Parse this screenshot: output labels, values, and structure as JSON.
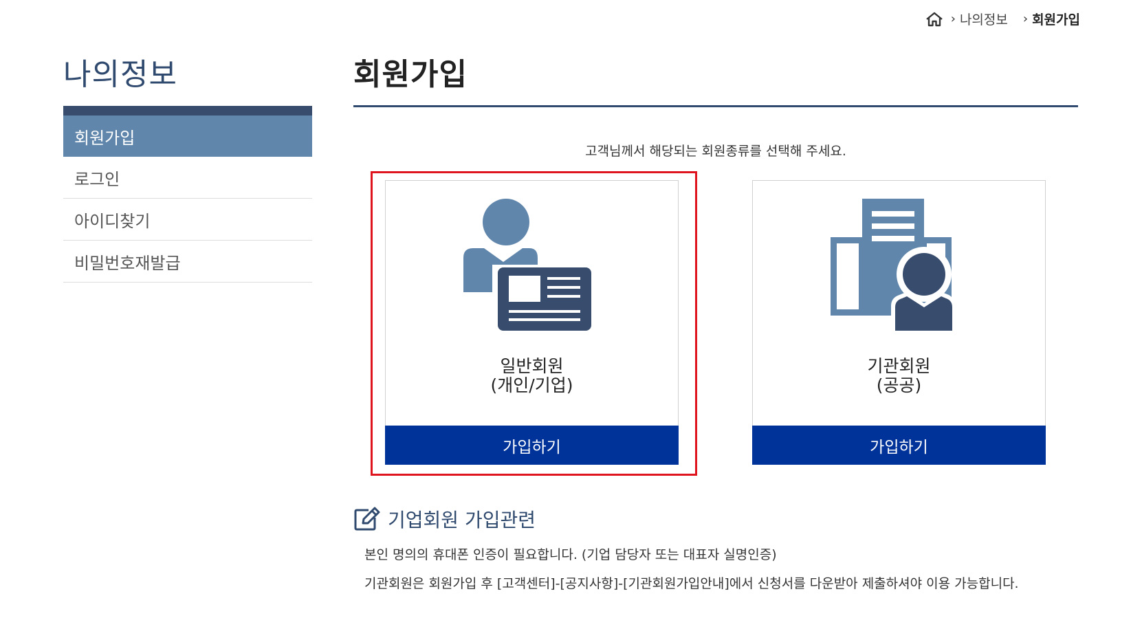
{
  "breadcrumb": {
    "home_icon": "home-icon",
    "items": [
      "나의정보",
      "회원가입"
    ]
  },
  "sidebar": {
    "title": "나의정보",
    "items": [
      {
        "label": "회원가입",
        "active": true
      },
      {
        "label": "로그인",
        "active": false
      },
      {
        "label": "아이디찾기",
        "active": false
      },
      {
        "label": "비밀번호재발급",
        "active": false
      }
    ]
  },
  "main": {
    "title": "회원가입",
    "instruction": "고객님께서 해당되는 회원종류를 선택해 주세요.",
    "cards": [
      {
        "icon": "person-id-card-icon",
        "label_line1": "일반회원",
        "label_line2": "(개인/기업)",
        "button": "가입하기"
      },
      {
        "icon": "building-person-icon",
        "label_line1": "기관회원",
        "label_line2": "(공공)",
        "button": "가입하기"
      }
    ]
  },
  "notice": {
    "icon": "edit-icon",
    "heading": "기업회원 가입관련",
    "lines": [
      "본인 명의의 휴대폰 인증이 필요합니다. (기업 담당자 또는 대표자 실명인증)",
      "기관회원은 회원가입 후 [고객센터]-[공지사항]-[기관회원가입안내]에서 신청서를 다운받아 제출하셔야 이용 가능합니다."
    ]
  },
  "colors": {
    "primary_button": "#003399",
    "sidebar_active": "#6086ac",
    "heading_dark": "#2f4a6e",
    "icon_light": "#6086ac",
    "icon_dark": "#384d6e",
    "highlight_border": "#e0141e"
  }
}
